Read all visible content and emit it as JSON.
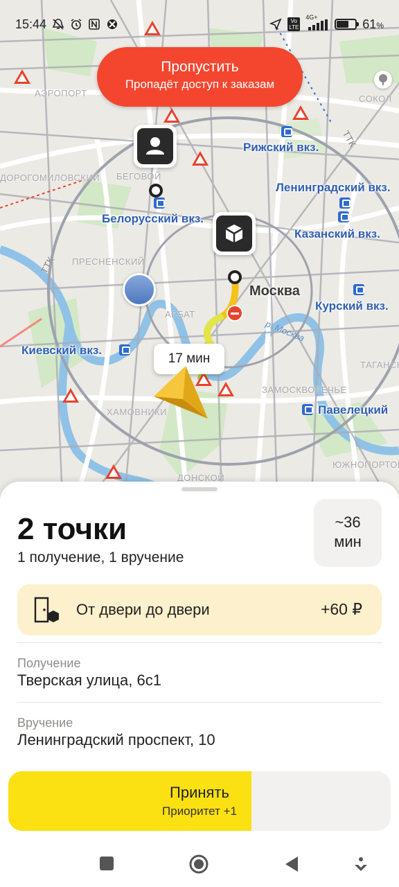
{
  "status_bar": {
    "time": "15:44",
    "battery": "61",
    "battery_unit": "%",
    "network": "4G+",
    "volte": "Vo LTE",
    "battery_level": 0.61,
    "left_icons": [
      "mute-icon",
      "alarm-icon",
      "nfc-icon",
      "vpn-icon"
    ],
    "right_icons": [
      "location-icon",
      "volte-icon",
      "signal-icon",
      "battery-icon"
    ]
  },
  "skip_button": {
    "title": "Пропустить",
    "subtitle": "Пропадёт доступ к заказам",
    "color": "#f4462f"
  },
  "map": {
    "stations": [
      "Рижский вкз.",
      "Ленинградский вкз.",
      "Белорусский вкз.",
      "Казанский вкз.",
      "Курский вкз.",
      "Киевский вкз.",
      "Павелецкий"
    ],
    "districts": [
      "АЭРОПОРТ",
      "СОКОЛ",
      "ДОРОГОМИЛОВСКИЙ",
      "БЕГОВОЙ",
      "ПРЕСНЕНСКИЙ",
      "АРБАТ",
      "ХАМОВНИКИ",
      "ЗАМОСКВОРЕЧЬЕ",
      "ТАГАНСКИЙ",
      "ЮЖНОПОРТОВЫЙ",
      "ДОНСКОЙ"
    ],
    "roads": [
      "ТТК",
      "ТТК"
    ],
    "city": "Москва",
    "river": "р. Москва",
    "eta": "17 мин",
    "route_colors": [
      "#e8432c",
      "#f5c21b",
      "#f2e13a",
      "#9fd83c"
    ]
  },
  "order": {
    "title": "2 точки",
    "subtitle": "1 получение, 1 вручение",
    "duration_value": "~36",
    "duration_unit": "мин",
    "option_label": "От двери до двери",
    "option_price": "+60 ₽",
    "pickup_caption": "Получение",
    "pickup_address": "Тверская улица, 6с1",
    "delivery_caption": "Вручение",
    "delivery_address": "Ленинградский проспект, 10"
  },
  "accept_button": {
    "title": "Принять",
    "subtitle": "Приоритет +1",
    "progress": 0.636,
    "color": "#fbe012"
  },
  "nav_bar": [
    "recents-button",
    "home-button",
    "back-button",
    "assistant-button"
  ]
}
